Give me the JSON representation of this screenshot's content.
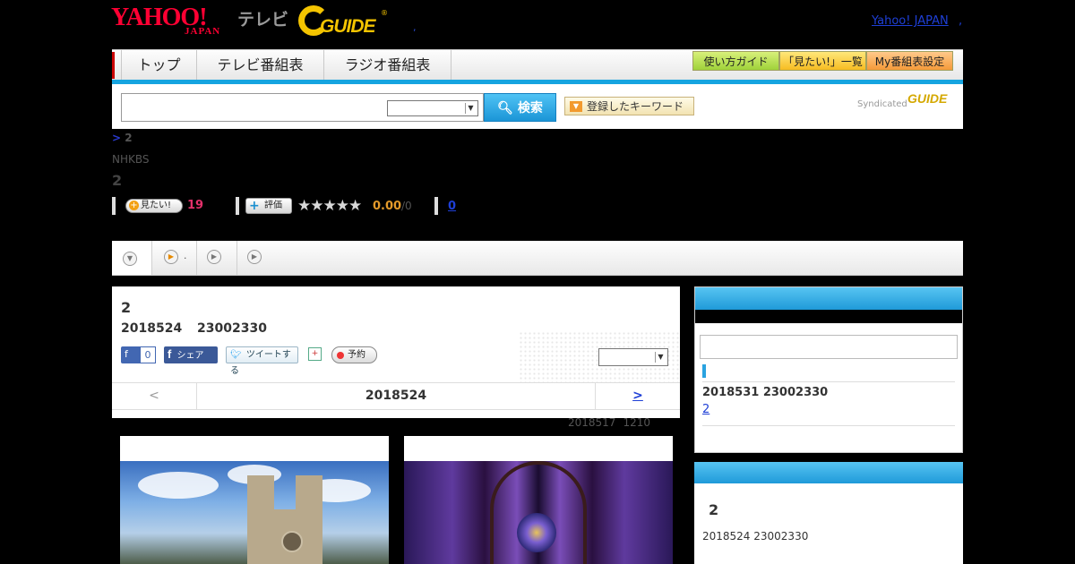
{
  "header": {
    "logo_yahoo": "YAHOO!",
    "logo_japan": "JAPAN",
    "logo_tv": "テレビ",
    "logo_gguide": "GUIDE",
    "logo_reg": "®",
    "dot": ",",
    "yahoo_japan_link": "Yahoo! JAPAN",
    "trailing_dot": ","
  },
  "nav": {
    "tabs": [
      {
        "label": "トップ"
      },
      {
        "label": "テレビ番組表"
      },
      {
        "label": "ラジオ番組表"
      }
    ],
    "right_buttons": [
      {
        "label": "使い方ガイド",
        "color": "#9fd23a"
      },
      {
        "label": "「見たい!」一覧",
        "color": "#f6bc22"
      },
      {
        "label": "My番組表設定",
        "color": "#f59a3a"
      }
    ]
  },
  "search": {
    "placeholder": "",
    "select_value": "",
    "button_label": "検索",
    "keyword_label": "登録したキーワード",
    "syndicated": "Syndicated",
    "syndicated_logo": "GUIDE"
  },
  "breadcrumb": {
    "sep": ">",
    "current": "2"
  },
  "program": {
    "channel": "NHKBS",
    "title": "2",
    "mitai_label": "見たい!",
    "mitai_count": "19",
    "hyoka_label": "評価",
    "stars": "★★★★★",
    "score": "0.00",
    "score_total": "/0",
    "comment_count": "0"
  },
  "subtabs": [
    {
      "icon": "down-arrow-icon",
      "date": ""
    },
    {
      "icon": "play-icon",
      "date": "."
    },
    {
      "icon": "play-icon",
      "date": ""
    },
    {
      "icon": "play-icon",
      "date": ""
    }
  ],
  "detail": {
    "title": "2",
    "date": "2018524",
    "time": "23002330",
    "like_label": "f",
    "like_count": "0",
    "share_label": "シェア",
    "share_f": "f",
    "tweet_label": "ツイートする",
    "yoyaku_label": "予約",
    "select_value": "",
    "pager_prev": "<",
    "pager_date": "2018524",
    "pager_next": ">",
    "prev_air_date": "2018517",
    "prev_air_time": "1210"
  },
  "side1": {
    "date": "2018531  23002330",
    "link": "2",
    "accent": "#1f9ad9"
  },
  "side2": {
    "title": "2",
    "date": "2018524  23002330"
  }
}
